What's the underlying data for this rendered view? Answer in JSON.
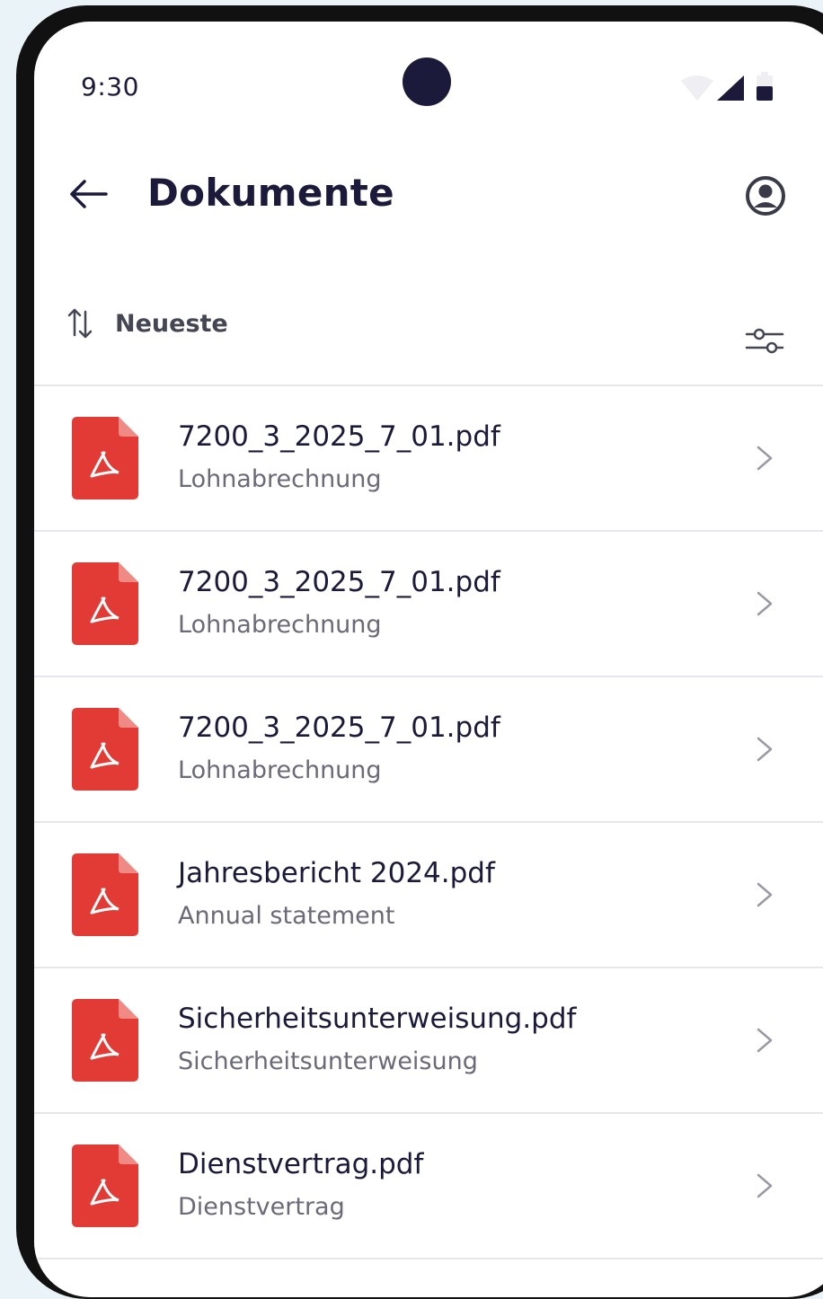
{
  "status_bar": {
    "time": "9:30",
    "icons": [
      "wifi-icon",
      "signal-icon",
      "battery-icon"
    ]
  },
  "header": {
    "title": "Dokumente",
    "back_icon": "arrow-left-icon",
    "profile_icon": "account-circle-icon"
  },
  "toolbar": {
    "sort_label": "Neueste",
    "sort_icon": "sort-arrows-icon",
    "filter_icon": "sliders-icon"
  },
  "documents": [
    {
      "name": "7200_3_2025_7_01.pdf",
      "type": "Lohnabrechnung"
    },
    {
      "name": "7200_3_2025_7_01.pdf",
      "type": "Lohnabrechnung"
    },
    {
      "name": "7200_3_2025_7_01.pdf",
      "type": "Lohnabrechnung"
    },
    {
      "name": "Jahresbericht 2024.pdf",
      "type": "Annual statement"
    },
    {
      "name": "Sicherheitsunterweisung.pdf",
      "type": "Sicherheitsunterweisung"
    },
    {
      "name": "Dienstvertrag.pdf",
      "type": "Dienstvertrag"
    }
  ],
  "colors": {
    "text_primary": "#1b1a3b",
    "text_secondary": "#6a6a78",
    "pdf_red": "#e23b35",
    "accent_blue": "#3a4bdc",
    "background": "#eaf3f8"
  }
}
